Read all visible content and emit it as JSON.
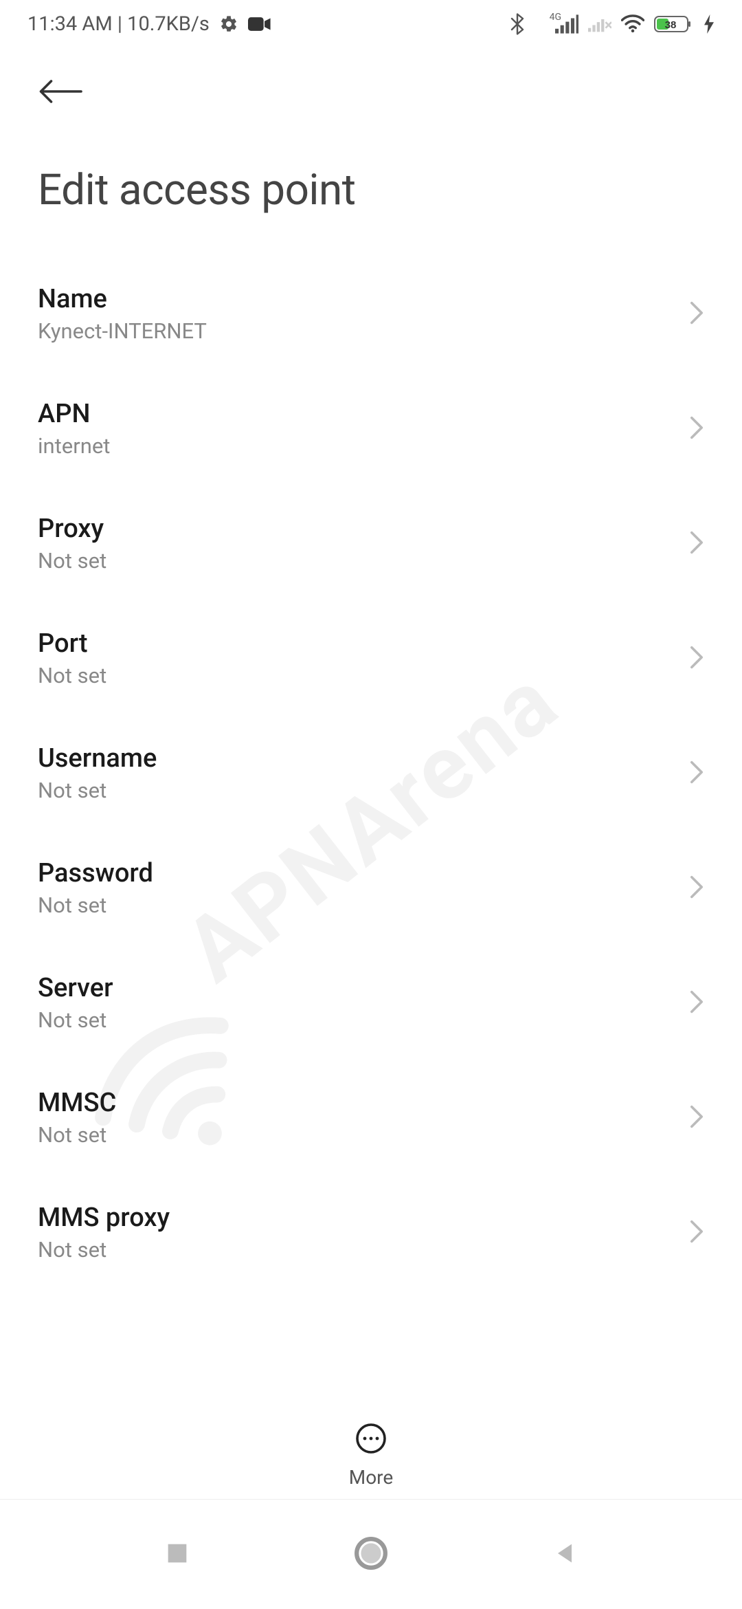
{
  "status_bar": {
    "time": "11:34 AM",
    "net_speed": "10.7KB/s",
    "network_label": "4G",
    "battery_pct": "38"
  },
  "header": {
    "title": "Edit access point"
  },
  "settings": [
    {
      "key": "name",
      "label": "Name",
      "value": "Kynect-INTERNET"
    },
    {
      "key": "apn",
      "label": "APN",
      "value": "internet"
    },
    {
      "key": "proxy",
      "label": "Proxy",
      "value": "Not set"
    },
    {
      "key": "port",
      "label": "Port",
      "value": "Not set"
    },
    {
      "key": "username",
      "label": "Username",
      "value": "Not set"
    },
    {
      "key": "password",
      "label": "Password",
      "value": "Not set"
    },
    {
      "key": "server",
      "label": "Server",
      "value": "Not set"
    },
    {
      "key": "mmsc",
      "label": "MMSC",
      "value": "Not set"
    },
    {
      "key": "mms_proxy",
      "label": "MMS proxy",
      "value": "Not set"
    }
  ],
  "more_label": "More",
  "watermark": "APNArena"
}
